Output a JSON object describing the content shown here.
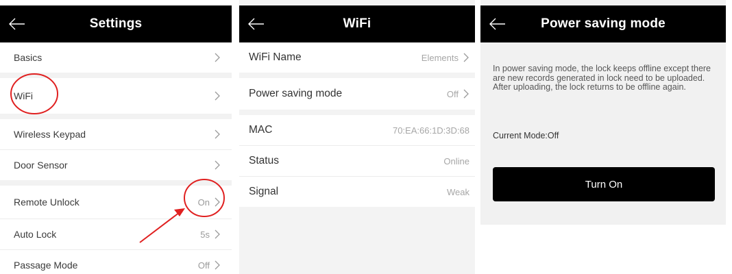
{
  "settings": {
    "title": "Settings",
    "rows": [
      {
        "label": "Basics",
        "value": ""
      },
      {
        "label": "WiFi",
        "value": ""
      },
      {
        "label": "Wireless Keypad",
        "value": ""
      },
      {
        "label": "Door Sensor",
        "value": ""
      },
      {
        "label": "Remote Unlock",
        "value": "On"
      },
      {
        "label": "Auto Lock",
        "value": "5s"
      },
      {
        "label": "Passage Mode",
        "value": "Off"
      }
    ]
  },
  "wifi": {
    "title": "WiFi",
    "rows": [
      {
        "label": "WiFi Name",
        "value": "Elements"
      },
      {
        "label": "Power saving mode",
        "value": "Off"
      },
      {
        "label": "MAC",
        "value": "70:EA:66:1D:3D:68"
      },
      {
        "label": "Status",
        "value": "Online"
      },
      {
        "label": "Signal",
        "value": "Weak"
      }
    ]
  },
  "power_saving": {
    "title": "Power saving mode",
    "description": "In power saving mode, the lock keeps offline except there are new records generated in lock need to be uploaded. After uploading, the lock returns to be offline again.",
    "current_mode": "Current Mode:Off",
    "button_label": "Turn On"
  },
  "colors": {
    "header": "#000000",
    "annotation": "#e02020"
  },
  "icons": {
    "back": "arrow-left-icon",
    "chevron": "chevron-right-icon"
  }
}
